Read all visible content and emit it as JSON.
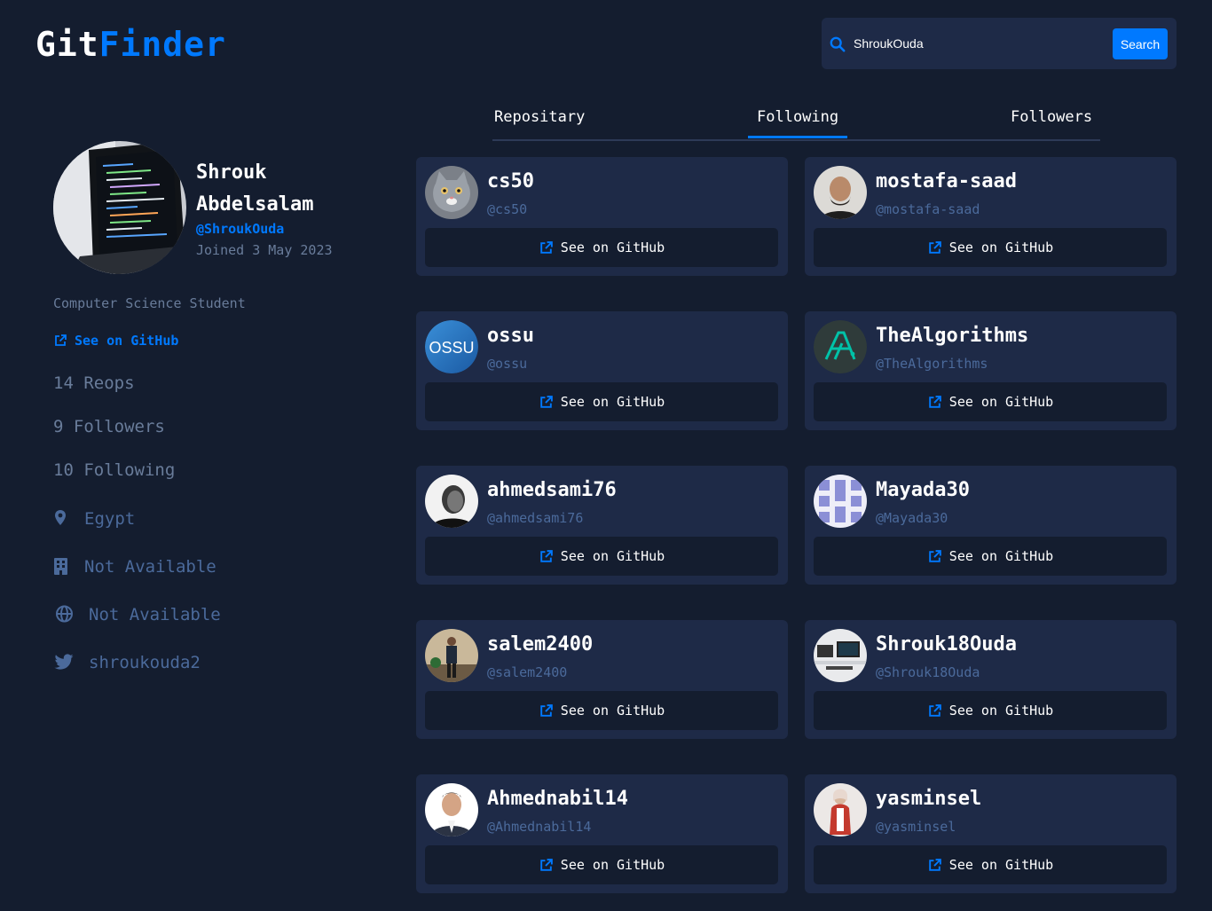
{
  "brand": {
    "part1": "Git",
    "part2": "Finder"
  },
  "search": {
    "value": "ShroukOuda",
    "button_label": "Search"
  },
  "profile": {
    "name": "Shrouk Abdelsalam",
    "login": "@ShroukOuda",
    "joined": "Joined 3 May 2023",
    "bio": "Computer Science Student",
    "github_link": "See on GitHub",
    "repos": "14 Reops",
    "followers": "9 Followers",
    "following": "10 Following",
    "location": "Egypt",
    "company": "Not Available",
    "website": "Not Available",
    "twitter": "shroukouda2"
  },
  "tabs": [
    {
      "label": "Repositary",
      "active": false
    },
    {
      "label": "Following",
      "active": true
    },
    {
      "label": "Followers",
      "active": false
    }
  ],
  "users": [
    {
      "name": "cs50",
      "login": "@cs50",
      "link": "See on GitHub"
    },
    {
      "name": "mostafa-saad",
      "login": "@mostafa-saad",
      "link": "See on GitHub"
    },
    {
      "name": "ossu",
      "login": "@ossu",
      "link": "See on GitHub",
      "avatar_text": "OSSU"
    },
    {
      "name": "TheAlgorithms",
      "login": "@TheAlgorithms",
      "link": "See on GitHub"
    },
    {
      "name": "ahmedsami76",
      "login": "@ahmedsami76",
      "link": "See on GitHub"
    },
    {
      "name": "Mayada30",
      "login": "@Mayada30",
      "link": "See on GitHub"
    },
    {
      "name": "salem2400",
      "login": "@salem2400",
      "link": "See on GitHub"
    },
    {
      "name": "Shrouk18Ouda",
      "login": "@Shrouk18Ouda",
      "link": "See on GitHub"
    },
    {
      "name": "Ahmednabil14",
      "login": "@Ahmednabil14",
      "link": "See on GitHub"
    },
    {
      "name": "yasminsel",
      "login": "@yasminsel",
      "link": "See on GitHub"
    }
  ],
  "colors": {
    "background": "#141d2f",
    "card": "#1e2a47",
    "accent": "#0079ff",
    "muted": "#697c9a",
    "muted_dark": "#4b6a9b"
  }
}
